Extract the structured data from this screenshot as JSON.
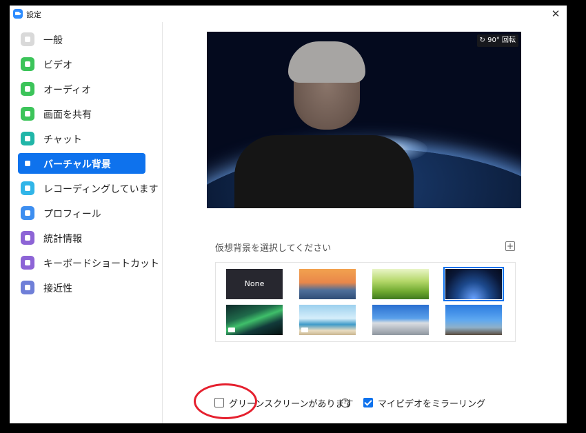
{
  "window": {
    "title": "設定",
    "close_glyph": "✕"
  },
  "colors": {
    "accent": "#0e72ed",
    "annotation": "#e5202e"
  },
  "sidebar": {
    "items": [
      {
        "label": "一般",
        "icon": "gear-icon",
        "color": "#d9d9d9",
        "active": false
      },
      {
        "label": "ビデオ",
        "icon": "video-camera-icon",
        "color": "#3cc45a",
        "active": false
      },
      {
        "label": "オーディオ",
        "icon": "headphones-icon",
        "color": "#3cc45a",
        "active": false
      },
      {
        "label": "画面を共有",
        "icon": "share-screen-icon",
        "color": "#3cc45a",
        "active": false
      },
      {
        "label": "チャット",
        "icon": "chat-bubble-icon",
        "color": "#21b6a8",
        "active": false
      },
      {
        "label": "バーチャル背景",
        "icon": "virtual-background-icon",
        "color": "#0e72ed",
        "active": true
      },
      {
        "label": "レコーディングしています",
        "icon": "record-icon",
        "color": "#31b5e8",
        "active": false
      },
      {
        "label": "プロフィール",
        "icon": "profile-icon",
        "color": "#3d8ef0",
        "active": false
      },
      {
        "label": "統計情報",
        "icon": "statistics-icon",
        "color": "#8d64d6",
        "active": false
      },
      {
        "label": "キーボードショートカット",
        "icon": "keyboard-icon",
        "color": "#8d64d6",
        "active": false
      },
      {
        "label": "接近性",
        "icon": "accessibility-icon",
        "color": "#6f7fd8",
        "active": false
      }
    ]
  },
  "preview": {
    "rotate_label": "↻ 90° 回転"
  },
  "background_select": {
    "label": "仮想背景を選択してください",
    "add_glyph": "+",
    "thumbnails": [
      {
        "name": "None",
        "kind": "none",
        "selected": false,
        "video": false
      },
      {
        "name": "golden-gate-bridge",
        "kind": "image",
        "selected": false,
        "video": false,
        "gradient": "linear-gradient(180deg,#f2a24f 0%,#e9874a 45%,#4e6f9a 70%,#2f4d77 100%)"
      },
      {
        "name": "grass",
        "kind": "image",
        "selected": false,
        "video": false,
        "gradient": "linear-gradient(180deg,#e9f5c8 0%,#b5d86a 40%,#6ea82f 75%,#3f7a1f 100%)"
      },
      {
        "name": "earth-space",
        "kind": "image",
        "selected": true,
        "video": false,
        "gradient": "radial-gradient(ellipse at 50% 100%,#6aa2ff 0%,#1d4a8e 40%,#0a1838 75%,#050a1a 100%)"
      },
      {
        "name": "aurora",
        "kind": "video",
        "selected": false,
        "video": true,
        "gradient": "linear-gradient(160deg,#0e2a2a 0%,#1f6a4a 35%,#3fbf6a 50%,#123a3a 70%,#05100f 100%)"
      },
      {
        "name": "beach",
        "kind": "video",
        "selected": false,
        "video": true,
        "gradient": "linear-gradient(180deg,#9cd0ee 0%,#d6eefa 45%,#3f9bc9 65%,#e9dcc0 85%,#c9b58f 100%)"
      },
      {
        "name": "building",
        "kind": "image",
        "selected": false,
        "video": false,
        "gradient": "linear-gradient(180deg,#2a6fd0 0%,#5aa0ea 45%,#d9dde2 60%,#8e969f 100%)"
      },
      {
        "name": "blossom-tree",
        "kind": "image",
        "selected": false,
        "video": false,
        "gradient": "linear-gradient(180deg,#2a7ae0 0%,#5ea8f0 50%,#8fb0c8 75%,#5a4b3d 100%)"
      }
    ]
  },
  "options": {
    "green_screen": {
      "label": "グリーンスクリーンがあります",
      "checked": false,
      "help_glyph": "?"
    },
    "mirror_video": {
      "label": "マイビデオをミラーリング",
      "checked": true
    }
  }
}
